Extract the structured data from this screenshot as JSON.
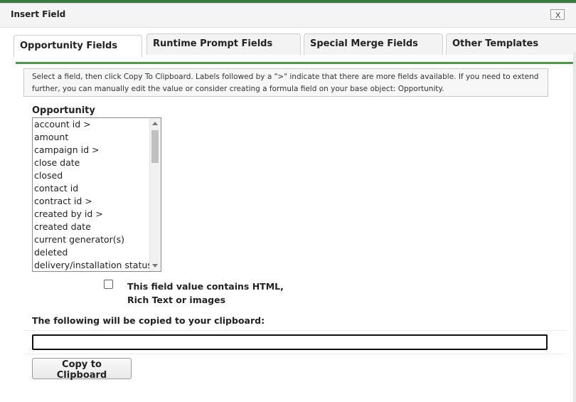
{
  "dialog": {
    "title": "Insert Field",
    "close_label": "X"
  },
  "tabs": [
    {
      "label": "Opportunity Fields",
      "active": true
    },
    {
      "label": "Runtime Prompt Fields",
      "active": false
    },
    {
      "label": "Special Merge Fields",
      "active": false
    },
    {
      "label": "Other Templates",
      "active": false
    }
  ],
  "info": {
    "line1": "Select a field, then click Copy To Clipboard. Labels followed by a \">\" indicate that there are more fields available. If you need to extend",
    "line2": "further, you can manually edit the value or consider creating a formula field on your base object: Opportunity."
  },
  "field_list": {
    "label": "Opportunity",
    "items": [
      "account id >",
      "amount",
      "campaign id >",
      "close date",
      "closed",
      "contact id",
      "contract id >",
      "created by id >",
      "created date",
      "current generator(s)",
      "deleted",
      "delivery/installation status"
    ]
  },
  "html_checkbox": {
    "label": "This field value contains HTML, Rich Text or images",
    "checked": false
  },
  "clipboard": {
    "label": "The following will be copied to your clipboard:",
    "value": ""
  },
  "copy_button": {
    "label": "Copy to Clipboard"
  },
  "colors": {
    "accent": "#4a9a4a",
    "topbar": "#3a7a3f"
  }
}
